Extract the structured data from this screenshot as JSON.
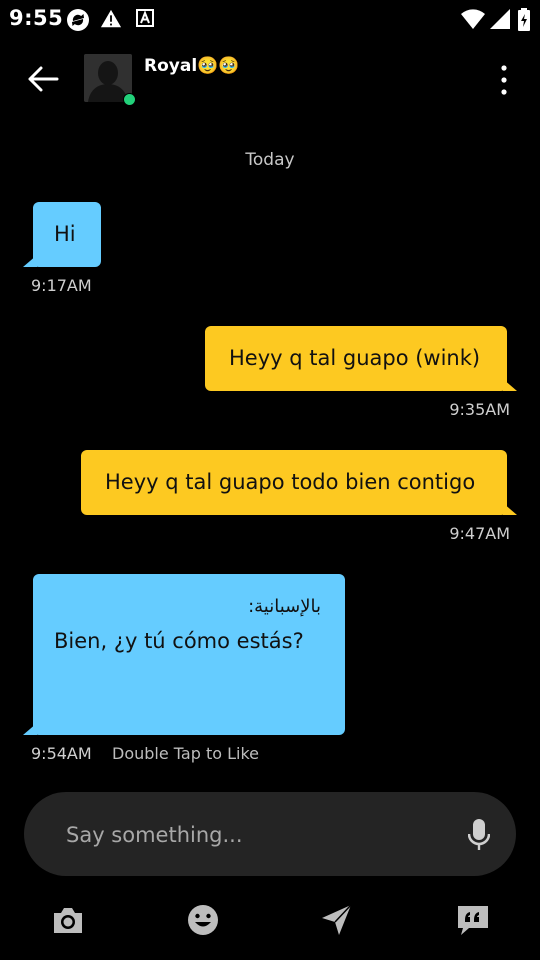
{
  "status_bar": {
    "time": "9:55",
    "icons": [
      "sync-icon",
      "alert-icon",
      "a-notification-icon",
      "wifi-icon",
      "signal-icon",
      "battery-icon"
    ]
  },
  "header": {
    "contact_name": "Royal🥹🥹",
    "online": true
  },
  "date_separator": "Today",
  "messages": [
    {
      "direction": "in",
      "text": "Hi",
      "time": "9:17AM"
    },
    {
      "direction": "out",
      "text": "Heyy q tal guapo (wink)",
      "time": "9:35AM"
    },
    {
      "direction": "out",
      "text": "Heyy q tal guapo todo bien contigo",
      "time": "9:47AM"
    },
    {
      "direction": "in",
      "translation_label": "بالإسبانية:",
      "text": "Bien, ¿y tú cómo estás?",
      "time": "9:54AM",
      "hint": "Double Tap to Like"
    }
  ],
  "composer": {
    "placeholder": "Say something..."
  },
  "toolbar": {
    "icons": [
      "camera-icon",
      "emoji-icon",
      "send-location-icon",
      "quick-phrases-icon"
    ]
  },
  "colors": {
    "incoming_bubble": "#65ccff",
    "outgoing_bubble": "#fdc921",
    "background": "#000000",
    "online": "#22d17a"
  }
}
